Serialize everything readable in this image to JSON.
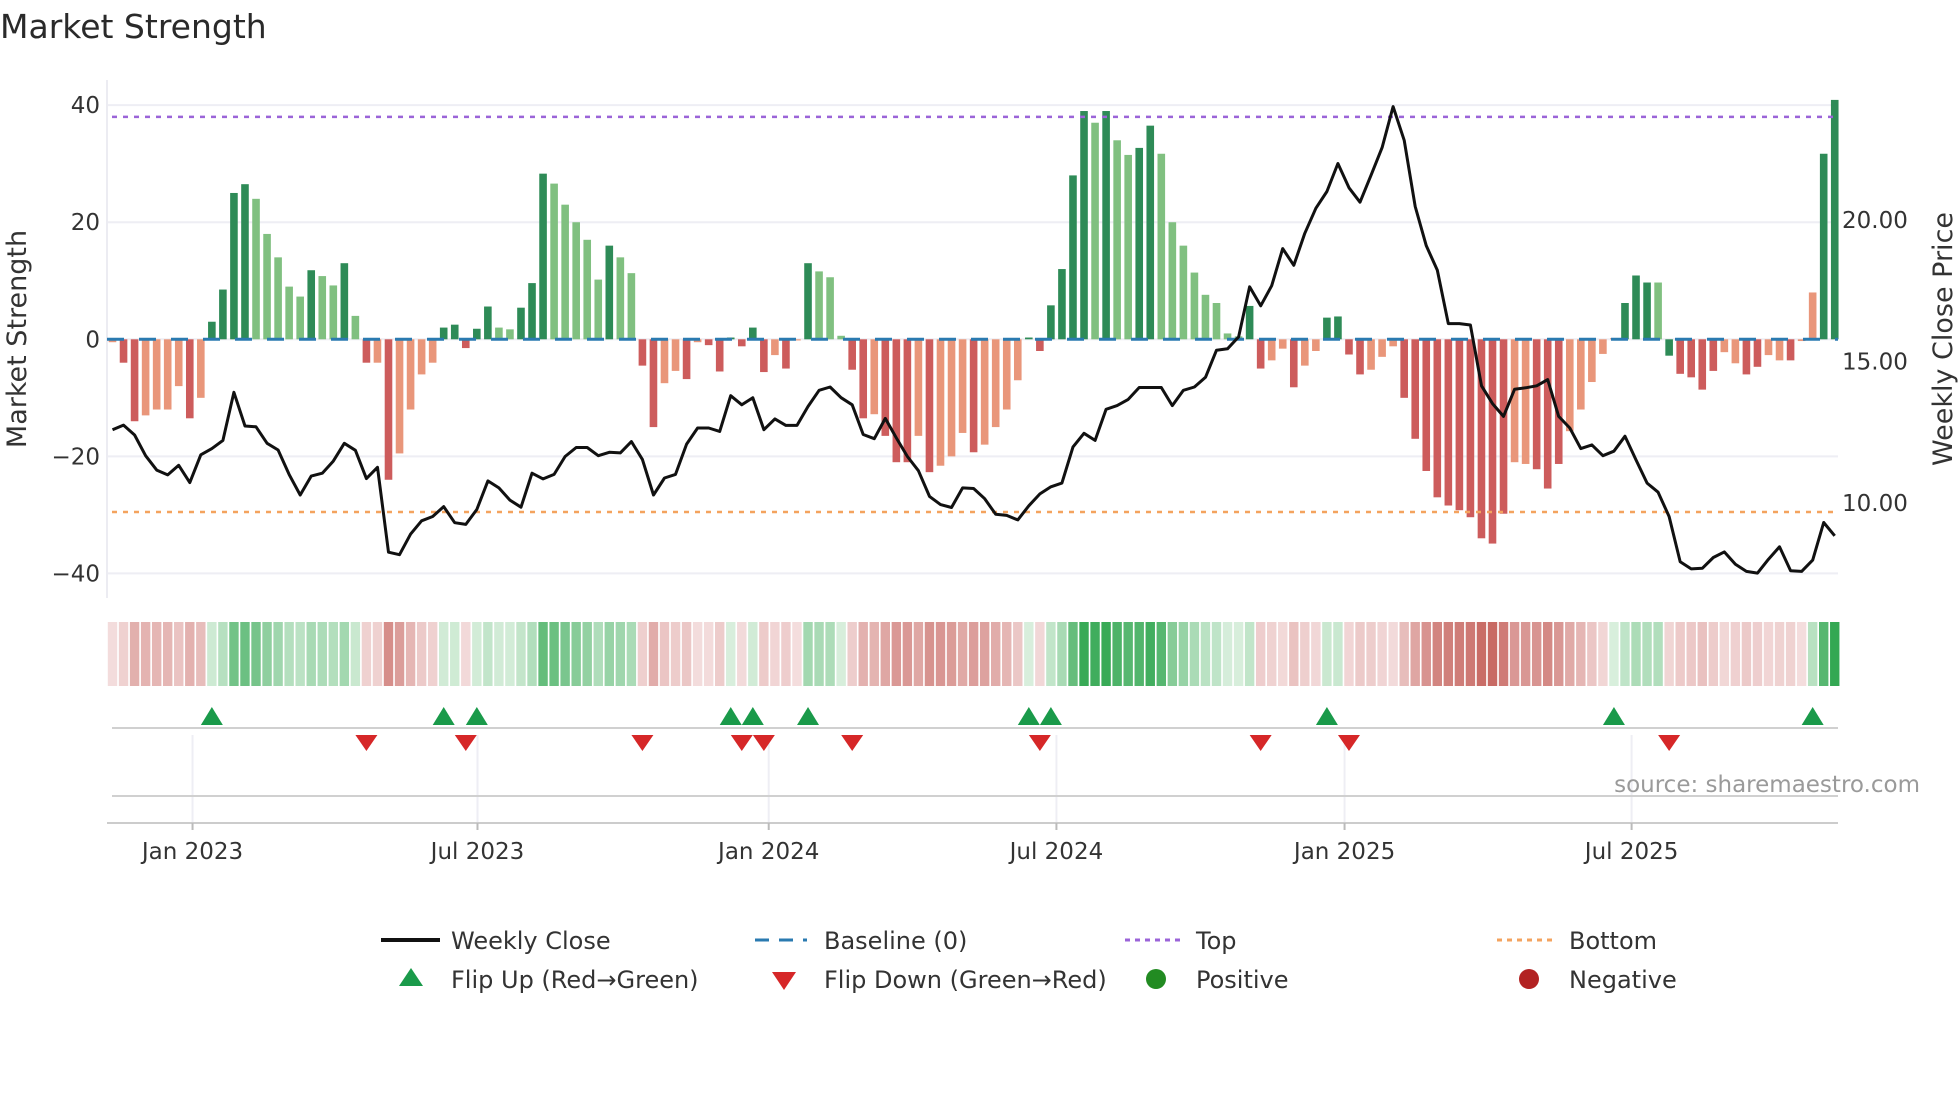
{
  "title": "Market Strength",
  "source": "source: sharemaestro.com",
  "colors": {
    "strong_green": "#2e8b57",
    "light_green": "#80c080",
    "strong_red": "#cd5c5c",
    "light_red": "#e9967a",
    "baseline": "#2a7ab0",
    "top": "#9b64d8",
    "bottom": "#f4a35e",
    "price_line": "#111111",
    "flip_up": "#1a9a4a",
    "flip_down": "#d62728",
    "positive": "#228b22",
    "negative": "#b22222"
  },
  "legend": [
    {
      "label": "Weekly Close",
      "icon": "solid-line"
    },
    {
      "label": "Baseline (0)",
      "icon": "dashed-line"
    },
    {
      "label": "Top",
      "icon": "dotted-line"
    },
    {
      "label": "Bottom",
      "icon": "dotted-line"
    },
    {
      "label": "Flip Up (Red→Green)",
      "icon": "triangle-up"
    },
    {
      "label": "Flip Down (Green→Red)",
      "icon": "triangle-down"
    },
    {
      "label": "Positive",
      "icon": "circle"
    },
    {
      "label": "Negative",
      "icon": "circle"
    }
  ],
  "chart_data": {
    "type": "bar",
    "title": "Market Strength",
    "ylabel": "Market Strength",
    "y2label": "Weekly Close Price",
    "ylim": [
      -44.2,
      44.3
    ],
    "y2lim": [
      6.64,
      24.95
    ],
    "yticks": [
      40,
      20,
      0,
      -20,
      -40
    ],
    "yticklabels": [
      "40",
      "20",
      "0",
      "−20",
      "−40"
    ],
    "y2ticks": [
      20,
      15,
      10
    ],
    "y2ticklabels": [
      "20.00",
      "15.00",
      "10.00"
    ],
    "x_ticks": [
      {
        "label": "Jan 2023",
        "week": 7.25
      },
      {
        "label": "Jul 2023",
        "week": 33.06
      },
      {
        "label": "Jan 2024",
        "week": 59.44
      },
      {
        "label": "Jul 2024",
        "week": 85.5
      },
      {
        "label": "Jan 2025",
        "week": 111.6
      },
      {
        "label": "Jul 2025",
        "week": 137.6
      }
    ],
    "top_level": 38,
    "bottom_level": -29.5,
    "baseline": 0,
    "strength": [
      -0.5,
      -4,
      -14,
      -13,
      -12,
      -12,
      -8,
      -13.5,
      -10,
      3,
      8.5,
      25,
      26.5,
      24,
      18,
      14,
      9,
      7.3,
      11.8,
      10.8,
      9.2,
      13,
      4,
      -4,
      -4,
      -24,
      -19.5,
      -12,
      -6,
      -4,
      2,
      2.5,
      -1.5,
      1.8,
      5.6,
      2,
      1.7,
      5.4,
      9.6,
      28.3,
      26.6,
      23,
      20,
      17,
      10.2,
      16,
      14,
      11.3,
      -4.5,
      -15,
      -7.5,
      -5.4,
      -6.8,
      -0.5,
      -1,
      -5.5,
      0.3,
      -1.2,
      2,
      -5.6,
      -2.7,
      -5,
      -0.2,
      13,
      11.6,
      10.6,
      0.6,
      -5.2,
      -13.5,
      -12.8,
      -16.5,
      -21,
      -21,
      -16.5,
      -22.7,
      -21.6,
      -20,
      -16,
      -19.3,
      -18,
      -15,
      -12,
      -7,
      0.3,
      -2,
      5.8,
      12,
      28,
      39,
      37,
      39,
      34,
      31.5,
      32.7,
      36.5,
      31.7,
      20,
      16,
      11.4,
      7.6,
      6.2,
      1,
      0.5,
      5.7,
      -5,
      -3.6,
      -1.6,
      -8.2,
      -4.5,
      -2,
      3.7,
      3.9,
      -2.6,
      -6,
      -5.2,
      -3,
      -1.2,
      -10,
      -17,
      -22.5,
      -27,
      -28.4,
      -29.2,
      -30.4,
      -34,
      -34.9,
      -29.8,
      -21,
      -21.3,
      -22.2,
      -25.5,
      -21.3,
      -15.7,
      -12,
      -7.3,
      -2.5,
      0.2,
      6.2,
      10.9,
      9.7,
      9.7,
      -2.8,
      -5.9,
      -6.5,
      -8.6,
      -5.4,
      -2.2,
      -4.1,
      -6,
      -4.7,
      -2.7,
      -3.6,
      -3.6,
      -0.3,
      8,
      31.7,
      40.9
    ],
    "strength_shade": "rRRrrrrRrGGGGgggggGggGgRrRrrrrGGRGGggGGGgggggGggRRrrRrRRGRGRrRrGgggRRrRRRrRrrrRrrrrGRGGGGgGggGGggggggggGRrrRrrGGRRrrrRRRRRRRRRRrrRRRrrrrrGGGgGRRRRrrRRrrRrrGGG",
    "weekly_close": [
      12.59,
      12.75,
      12.4,
      11.67,
      11.16,
      10.99,
      11.33,
      10.72,
      11.7,
      11.92,
      12.21,
      13.91,
      12.72,
      12.69,
      12.11,
      11.87,
      11.01,
      10.28,
      10.95,
      11.05,
      11.48,
      12.11,
      11.86,
      10.86,
      11.26,
      8.26,
      8.17,
      8.9,
      9.37,
      9.52,
      9.87,
      9.3,
      9.24,
      9.77,
      10.78,
      10.53,
      10.1,
      9.85,
      11.05,
      10.85,
      11.01,
      11.64,
      11.96,
      11.96,
      11.67,
      11.79,
      11.77,
      12.17,
      11.54,
      10.28,
      10.88,
      11.01,
      12.08,
      12.65,
      12.65,
      12.53,
      13.79,
      13.47,
      13.72,
      12.59,
      12.97,
      12.74,
      12.74,
      13.41,
      13.98,
      14.1,
      13.72,
      13.47,
      12.42,
      12.27,
      12.99,
      12.3,
      11.64,
      11.14,
      10.23,
      9.94,
      9.84,
      10.53,
      10.51,
      10.15,
      9.6,
      9.56,
      9.4,
      9.9,
      10.32,
      10.57,
      10.7,
      11.98,
      12.46,
      12.21,
      13.31,
      13.44,
      13.66,
      14.08,
      14.08,
      14.08,
      13.44,
      13.98,
      14.1,
      14.44,
      15.4,
      15.45,
      15.87,
      17.64,
      16.97,
      17.68,
      18.99,
      18.4,
      19.53,
      20.42,
      21.01,
      22.0,
      21.14,
      20.63,
      21.59,
      22.56,
      24.01,
      22.82,
      20.48,
      19.09,
      18.23,
      16.34,
      16.34,
      16.29,
      14.14,
      13.51,
      13.06,
      14.02,
      14.07,
      14.14,
      14.36,
      13.06,
      12.65,
      11.92,
      12.05,
      11.67,
      11.83,
      12.36,
      11.52,
      10.7,
      10.38,
      9.52,
      7.92,
      7.67,
      7.69,
      8.07,
      8.27,
      7.83,
      7.58,
      7.52,
      8.01,
      8.45,
      7.6,
      7.58,
      7.98,
      9.31,
      8.84
    ]
  }
}
